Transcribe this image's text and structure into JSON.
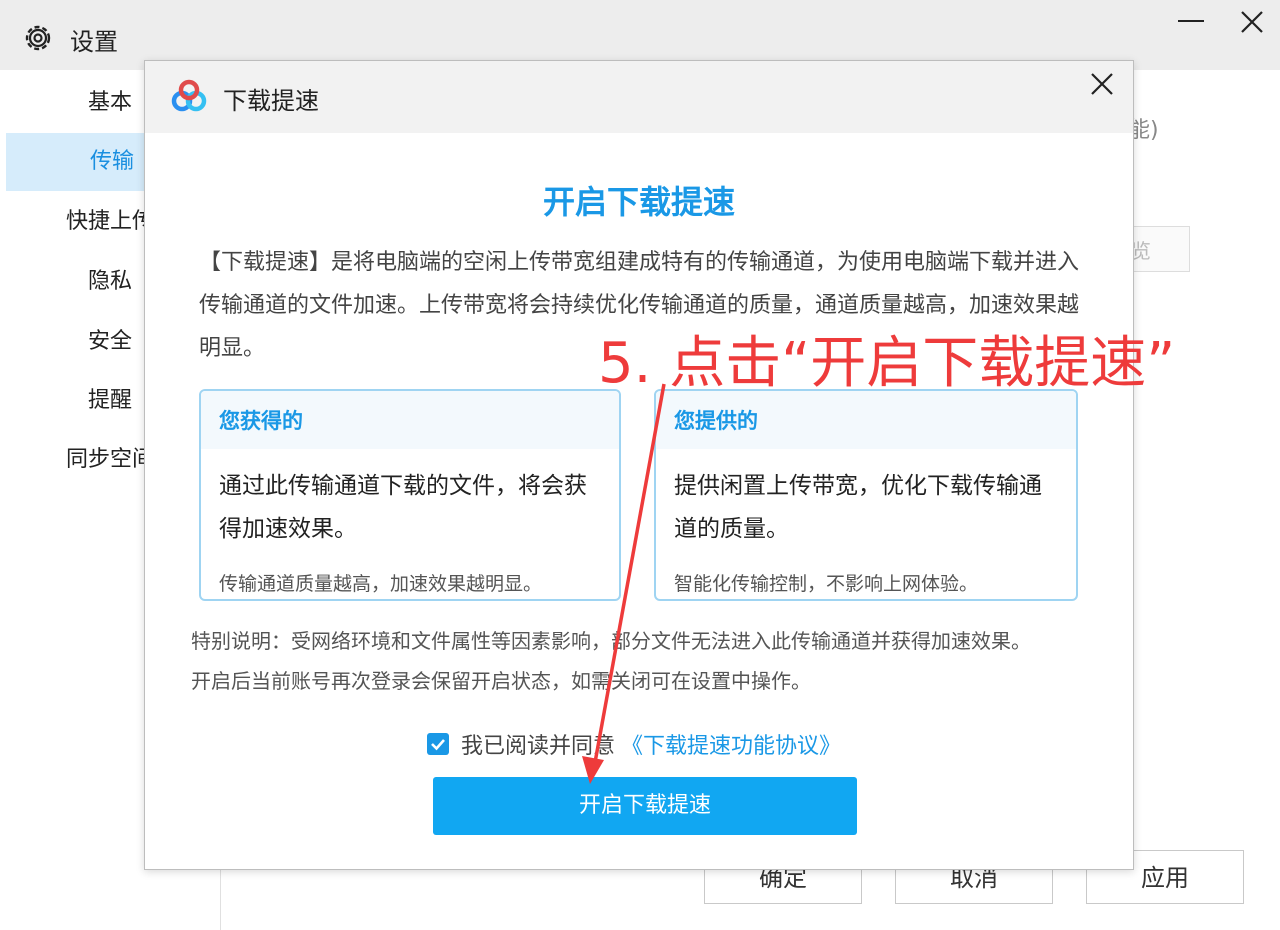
{
  "window": {
    "title": "设置"
  },
  "sidebar": {
    "items": [
      {
        "label": "基本"
      },
      {
        "label": "传输"
      },
      {
        "label": "快捷上传"
      },
      {
        "label": "隐私"
      },
      {
        "label": "安全"
      },
      {
        "label": "提醒"
      },
      {
        "label": "同步空间"
      }
    ],
    "active": "传输"
  },
  "background": {
    "hint_text": "能)",
    "box_text": "览",
    "buttons": {
      "ok": "确定",
      "cancel": "取消",
      "apply": "应用"
    }
  },
  "dialog": {
    "title": "下载提速",
    "heading": "开启下载提速",
    "description": "【下载提速】是将电脑端的空闲上传带宽组建成特有的传输通道，为使用电脑端下载并进入传输通道的文件加速。上传带宽将会持续优化传输通道的质量，通道质量越高，加速效果越明显。",
    "cards": [
      {
        "title": "您获得的",
        "main": "通过此传输通道下载的文件，将会获得加速效果。",
        "sub": "传输通道质量越高，加速效果越明显。"
      },
      {
        "title": "您提供的",
        "main": "提供闲置上传带宽，优化下载传输通道的质量。",
        "sub": "智能化传输控制，不影响上网体验。"
      }
    ],
    "note_line1": "特别说明：受网络环境和文件属性等因素影响，部分文件无法进入此传输通道并获得加速效果。",
    "note_line2": "开启后当前账号再次登录会保留开启状态，如需关闭可在设置中操作。",
    "agree_text": "我已阅读并同意",
    "agree_link": "《下载提速功能协议》",
    "agree_checked": true,
    "primary_button": "开启下载提速"
  },
  "annotation": {
    "text": "5. 点击“开启下载提速”",
    "color": "#ee3b3b"
  },
  "colors": {
    "accent": "#1a98e6",
    "button": "#11a7f2"
  }
}
